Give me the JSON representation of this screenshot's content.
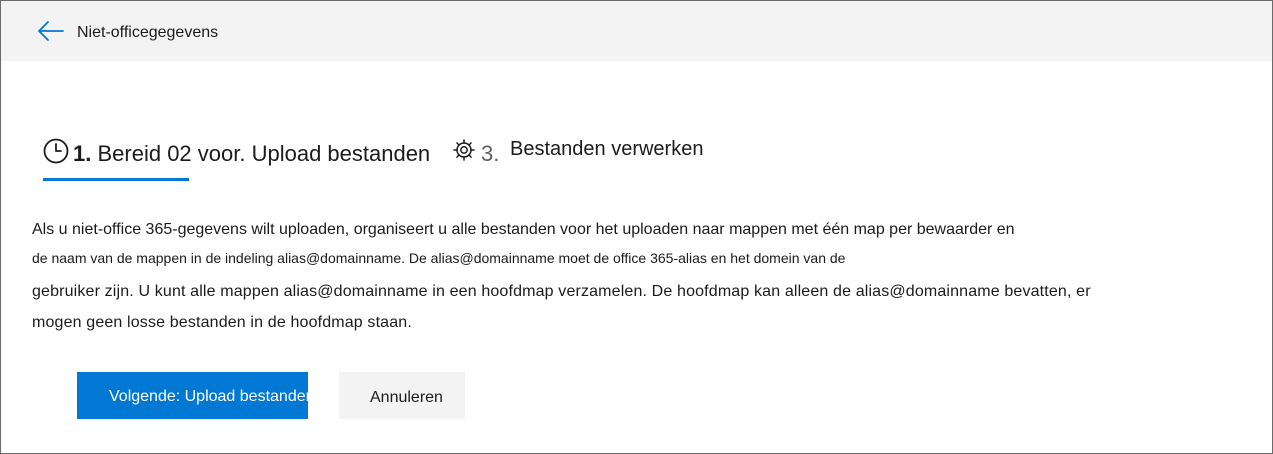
{
  "header": {
    "title": "Niet-officegegevens",
    "back_icon": "arrow-left-icon"
  },
  "steps": {
    "step1_number": "1.",
    "step1_label": "Bereid 02 voor. Upload bestanden",
    "step3_number": "3.",
    "step3_label": "Bestanden verwerken",
    "step1_icon": "clock-icon",
    "step3_icon": "gear-icon"
  },
  "description": {
    "line1": "Als u niet-office 365-gegevens wilt uploaden, organiseert u alle bestanden voor het uploaden naar mappen met één map per bewaarder en",
    "line2": "de naam van de mappen in de indeling alias@domainname. De alias@domainname moet de office 365-alias en het domein van de",
    "line3": "gebruiker zijn. U kunt alle mappen alias@domainname in een hoofdmap verzamelen. De hoofdmap kan alleen de alias@domainname bevatten, er",
    "line4": "mogen geen losse bestanden in de hoofdmap staan."
  },
  "buttons": {
    "next_label": "Volgende: Upload bestanden",
    "cancel_label": "Annuleren"
  },
  "colors": {
    "accent": "#0078d4",
    "header_bg": "#f3f3f3",
    "cancel_bg": "#f3f3f3"
  }
}
